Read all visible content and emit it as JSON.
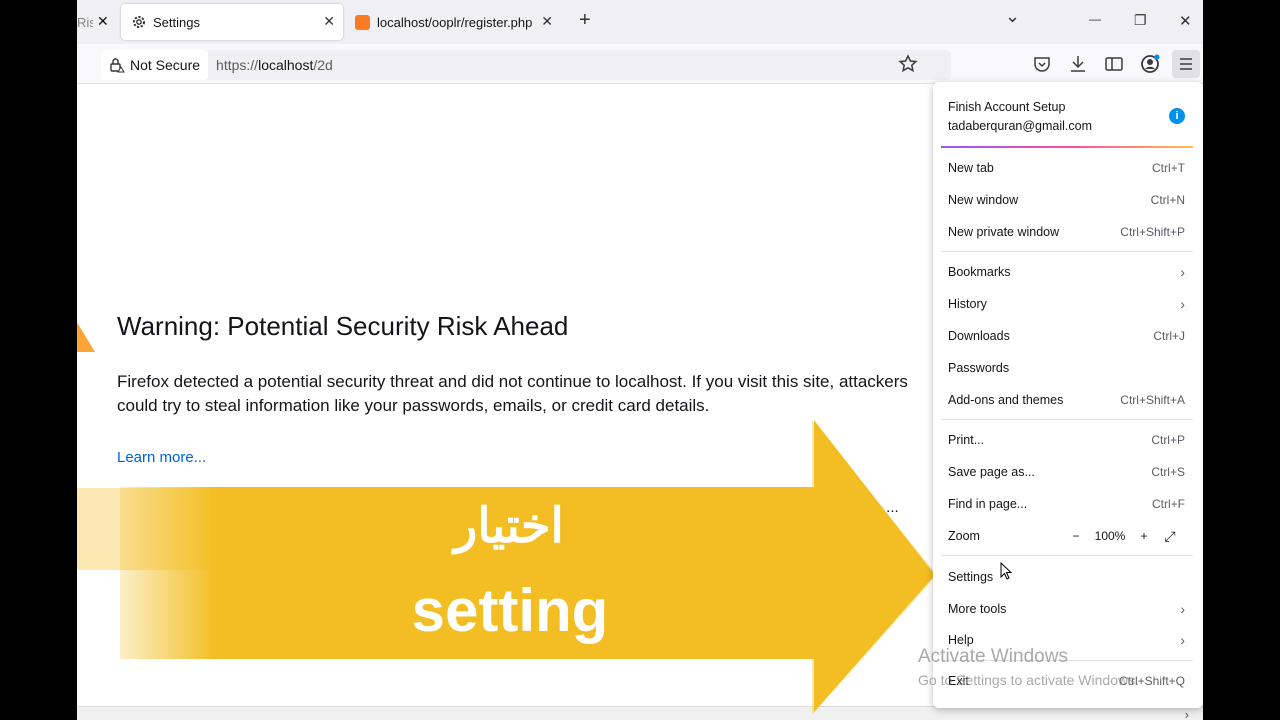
{
  "tabs": [
    {
      "label": "Risk",
      "close": "✕"
    },
    {
      "label": "Settings",
      "close": "✕"
    },
    {
      "label": "localhost/ooplr/register.php",
      "close": "✕"
    }
  ],
  "new_tab": "+",
  "window": {
    "list_tabs": "⌄",
    "minimize": "—",
    "maximize": "❐",
    "close": "✕"
  },
  "urlbar": {
    "security_label": "Not Secure",
    "url_scheme": "https://",
    "url_host": "localhost",
    "url_path": "/2d"
  },
  "page": {
    "title": "Warning: Potential Security Risk Ahead",
    "body": "Firefox detected a potential security threat and did not continue to localhost. If you visit this site, attackers could try to steal information like your passwords, emails, or credit card details.",
    "learn_more": "Learn more...",
    "advanced_partial": "...."
  },
  "overlay": {
    "arabic": "اختيار",
    "english": "setting",
    "arrow_color": "#f3be23"
  },
  "menu": {
    "account_title": "Finish Account Setup",
    "account_email": "tadaberquran@gmail.com",
    "account_info": "i",
    "items": [
      {
        "label": "New tab",
        "shortcut": "Ctrl+T"
      },
      {
        "label": "New window",
        "shortcut": "Ctrl+N"
      },
      {
        "label": "New private window",
        "shortcut": "Ctrl+Shift+P"
      },
      {
        "label": "Bookmarks",
        "shortcut": ""
      },
      {
        "label": "History",
        "shortcut": ""
      },
      {
        "label": "Downloads",
        "shortcut": "Ctrl+J"
      },
      {
        "label": "Passwords",
        "shortcut": ""
      },
      {
        "label": "Add-ons and themes",
        "shortcut": "Ctrl+Shift+A"
      },
      {
        "label": "Print...",
        "shortcut": "Ctrl+P"
      },
      {
        "label": "Save page as...",
        "shortcut": "Ctrl+S"
      },
      {
        "label": "Find in page...",
        "shortcut": "Ctrl+F"
      },
      {
        "label": "Zoom",
        "shortcut": ""
      },
      {
        "label": "Settings",
        "shortcut": ""
      },
      {
        "label": "More tools",
        "shortcut": ""
      },
      {
        "label": "Help",
        "shortcut": ""
      },
      {
        "label": "Exit",
        "shortcut": "Ctrl+Shift+Q"
      }
    ],
    "zoom": {
      "minus": "−",
      "value": "100%",
      "plus": "+",
      "fullscreen": "⤢"
    },
    "chevron": "›"
  },
  "watermark": {
    "line1": "Activate Windows",
    "line2": "Go to Settings to activate Windows."
  }
}
